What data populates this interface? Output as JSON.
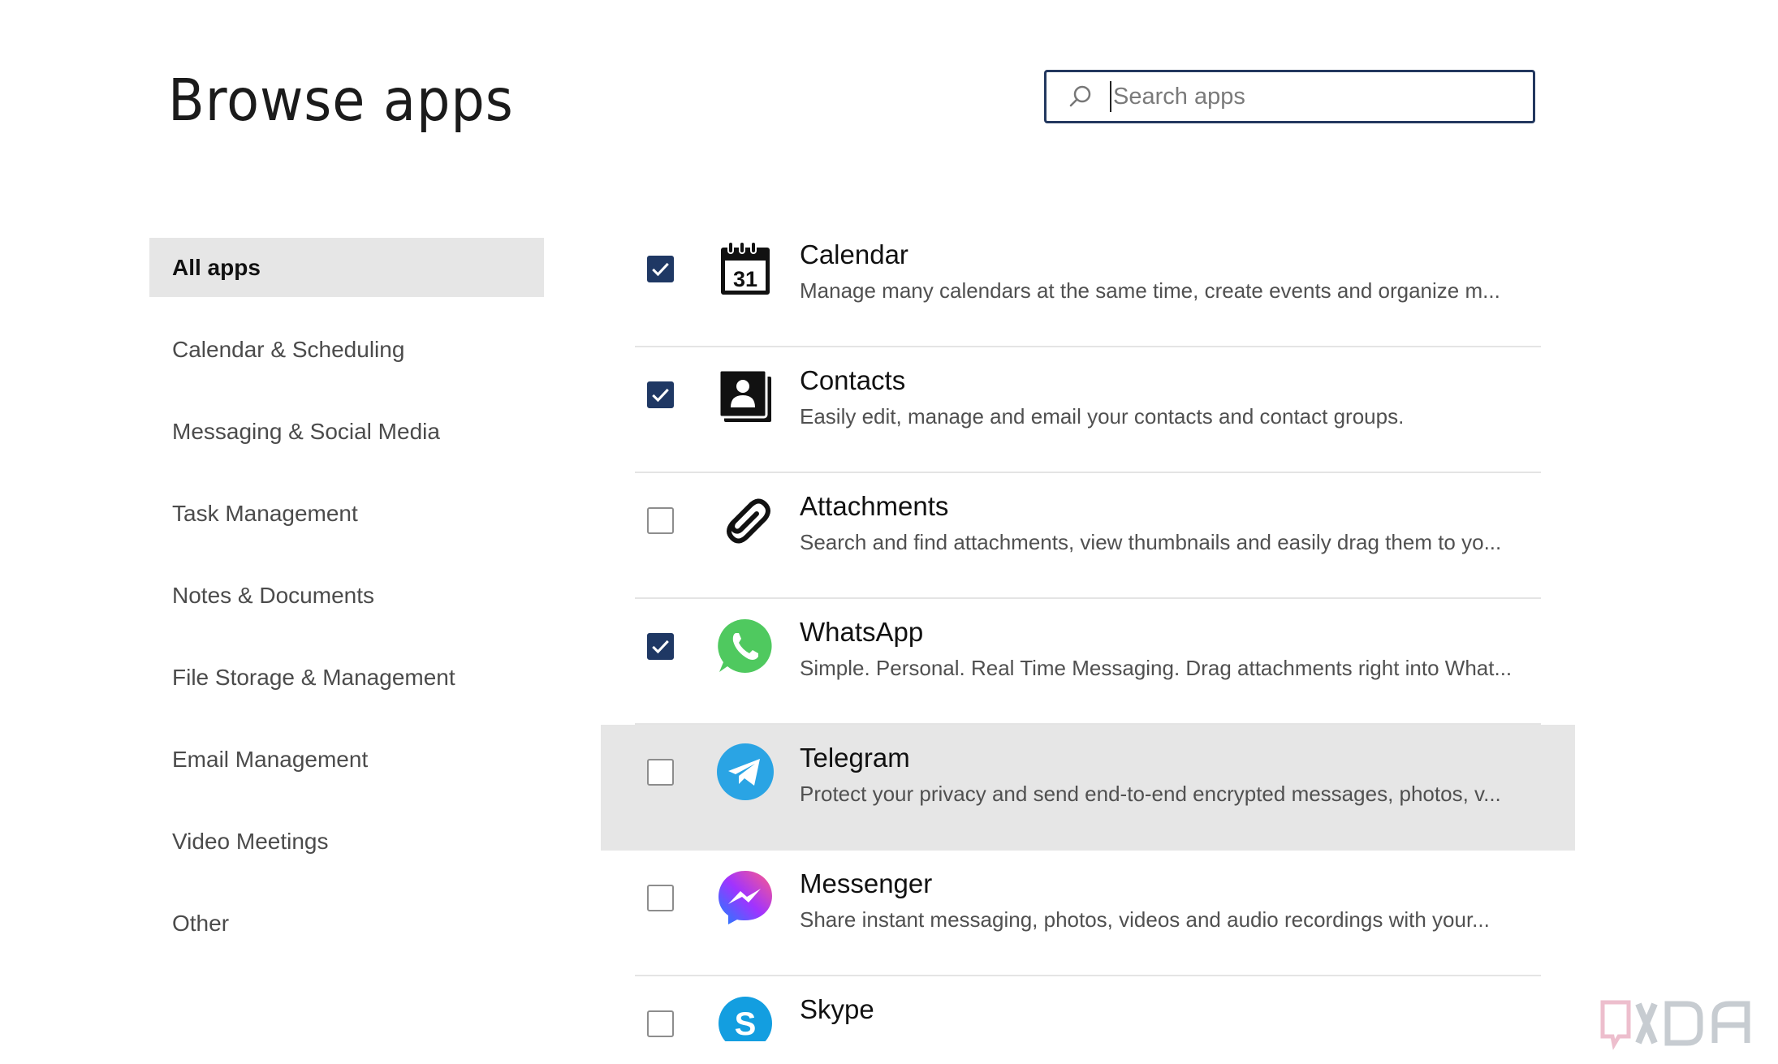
{
  "header": {
    "title": "Browse apps"
  },
  "search": {
    "placeholder": "Search apps",
    "value": ""
  },
  "sidebar": {
    "items": [
      {
        "label": "All apps",
        "active": true
      },
      {
        "label": "Calendar & Scheduling"
      },
      {
        "label": "Messaging & Social Media"
      },
      {
        "label": "Task Management"
      },
      {
        "label": "Notes & Documents"
      },
      {
        "label": "File Storage & Management"
      },
      {
        "label": "Email Management"
      },
      {
        "label": "Video Meetings"
      },
      {
        "label": "Other"
      }
    ]
  },
  "apps": [
    {
      "name": "Calendar",
      "desc": "Manage many calendars at the same time, create events and organize m...",
      "checked": true,
      "icon": "calendar-icon",
      "icon_text": "31"
    },
    {
      "name": "Contacts",
      "desc": "Easily edit, manage and email your contacts and contact groups.",
      "checked": true,
      "icon": "contacts-icon"
    },
    {
      "name": "Attachments",
      "desc": "Search and find attachments, view thumbnails and easily drag them to yo...",
      "checked": false,
      "icon": "paperclip-icon"
    },
    {
      "name": "WhatsApp",
      "desc": "Simple. Personal. Real Time Messaging. Drag attachments right into What...",
      "checked": true,
      "icon": "whatsapp-icon",
      "color": "#4fc95f"
    },
    {
      "name": "Telegram",
      "desc": "Protect your privacy and send end-to-end encrypted messages, photos, v...",
      "checked": false,
      "icon": "telegram-icon",
      "color": "#2aa4e4",
      "hovered": true
    },
    {
      "name": "Messenger",
      "desc": "Share instant messaging, photos, videos and audio recordings with your...",
      "checked": false,
      "icon": "messenger-icon"
    },
    {
      "name": "Skype",
      "desc": "",
      "checked": false,
      "icon": "skype-icon",
      "color": "#139ee0"
    }
  ],
  "colors": {
    "accent": "#1f3864",
    "hover_bg": "#e6e6e6",
    "search_border": "#23385f"
  },
  "watermark": {
    "icon": "xda-logo"
  }
}
